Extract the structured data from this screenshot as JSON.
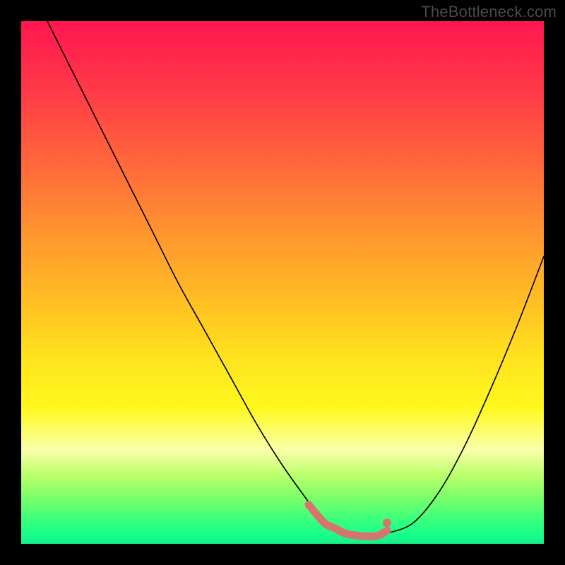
{
  "brand": "TheBottleneck.com",
  "chart_data": {
    "type": "line",
    "title": "",
    "xlabel": "",
    "ylabel": "",
    "xlim": [
      0,
      100
    ],
    "ylim": [
      0,
      100
    ],
    "grid": false,
    "legend": false,
    "series": [
      {
        "name": "main-curve",
        "color": "#000000",
        "stroke_width": 1.6,
        "x": [
          5,
          10,
          15,
          20,
          25,
          30,
          35,
          40,
          45,
          50,
          55,
          58,
          60,
          62,
          65,
          68,
          70,
          75,
          80,
          85,
          90,
          95,
          100
        ],
        "y": [
          100,
          90,
          80,
          70,
          60,
          50,
          41,
          32,
          23,
          15,
          8,
          4,
          3,
          2,
          1.5,
          1.5,
          2,
          4,
          10,
          19,
          30,
          42,
          55
        ]
      },
      {
        "name": "optimal-band",
        "color": "#d6756c",
        "stroke_width": 11,
        "x": [
          55,
          58,
          60,
          62,
          65,
          68,
          70
        ],
        "y": [
          7.5,
          4,
          3,
          2,
          1.5,
          1.5,
          2.5
        ]
      }
    ],
    "markers": [
      {
        "name": "band-end-dot",
        "x": 70,
        "y": 4,
        "r": 6,
        "color": "#d6756c"
      }
    ]
  }
}
